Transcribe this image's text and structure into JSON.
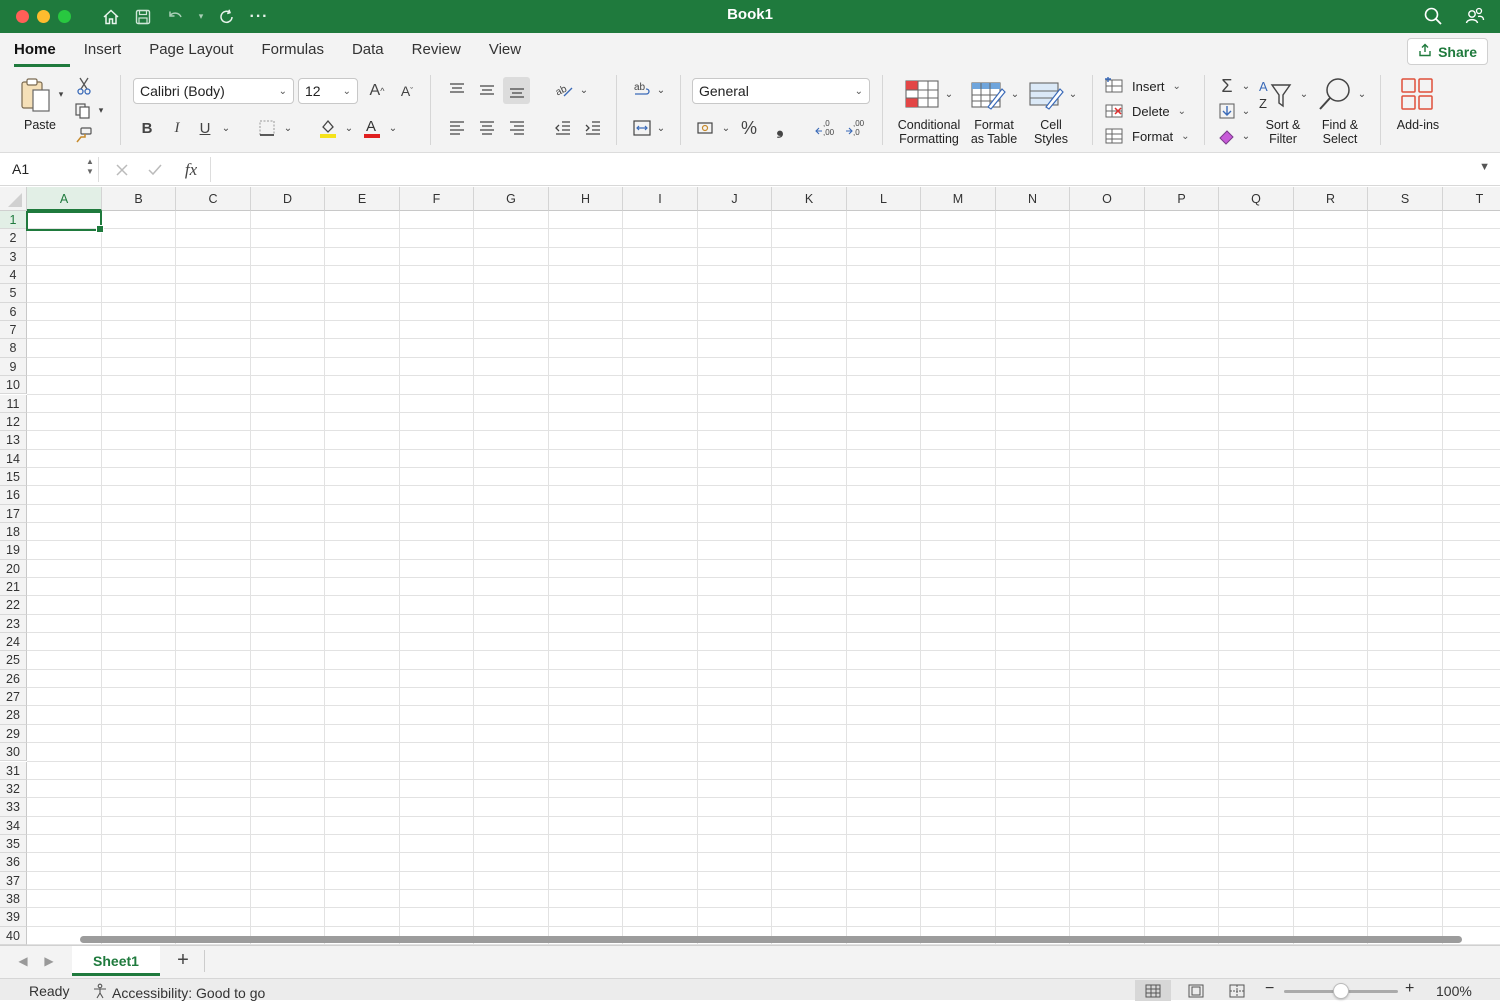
{
  "window": {
    "title": "Book1"
  },
  "menu": {
    "tabs": [
      "Home",
      "Insert",
      "Page Layout",
      "Formulas",
      "Data",
      "Review",
      "View"
    ],
    "share_label": "Share"
  },
  "ribbon": {
    "paste_label": "Paste",
    "font_name": "Calibri (Body)",
    "font_size": "12",
    "bold": "B",
    "italic": "I",
    "underline": "U",
    "number_format": "General",
    "percent": "%",
    "comma": "❟",
    "conditional_formatting": [
      "Conditional",
      "Formatting"
    ],
    "format_as_table": [
      "Format",
      "as Table"
    ],
    "cell_styles": [
      "Cell",
      "Styles"
    ],
    "insert_label": "Insert",
    "delete_label": "Delete",
    "format_label": "Format",
    "sort_filter": [
      "Sort &",
      "Filter"
    ],
    "find_select": [
      "Find &",
      "Select"
    ],
    "addins_label": "Add-ins"
  },
  "formula_bar": {
    "name_box": "A1",
    "fx": "fx",
    "formula": ""
  },
  "grid": {
    "columns": [
      "A",
      "B",
      "C",
      "D",
      "E",
      "F",
      "G",
      "H",
      "I",
      "J",
      "K",
      "L",
      "M",
      "N",
      "O",
      "P",
      "Q",
      "R",
      "S",
      "T"
    ],
    "rows": [
      "1",
      "2",
      "3",
      "4",
      "5",
      "6",
      "7",
      "8",
      "9",
      "10",
      "11",
      "12",
      "13",
      "14",
      "15",
      "16",
      "17",
      "18",
      "19",
      "20",
      "21",
      "22",
      "23",
      "24",
      "25",
      "26",
      "27",
      "28",
      "29",
      "30",
      "31",
      "32",
      "33",
      "34",
      "35",
      "36",
      "37",
      "38",
      "39",
      "40"
    ],
    "selected_cell": "A1"
  },
  "sheets": {
    "tabs": [
      "Sheet1"
    ],
    "active": "Sheet1",
    "add_label": "+"
  },
  "status": {
    "ready": "Ready",
    "accessibility": "Accessibility: Good to go",
    "zoom": "100%",
    "zoom_minus": "−",
    "zoom_plus": "+"
  },
  "colors": {
    "accent": "#1f7a3d",
    "titlebar": "#1f7a3d"
  },
  "icons": [
    "home-icon",
    "save-icon",
    "undo-icon",
    "redo-icon",
    "more-icon",
    "search-icon",
    "collaborate-icon",
    "share-icon",
    "paste-icon",
    "cut-icon",
    "copy-icon",
    "format-painter-icon"
  ]
}
